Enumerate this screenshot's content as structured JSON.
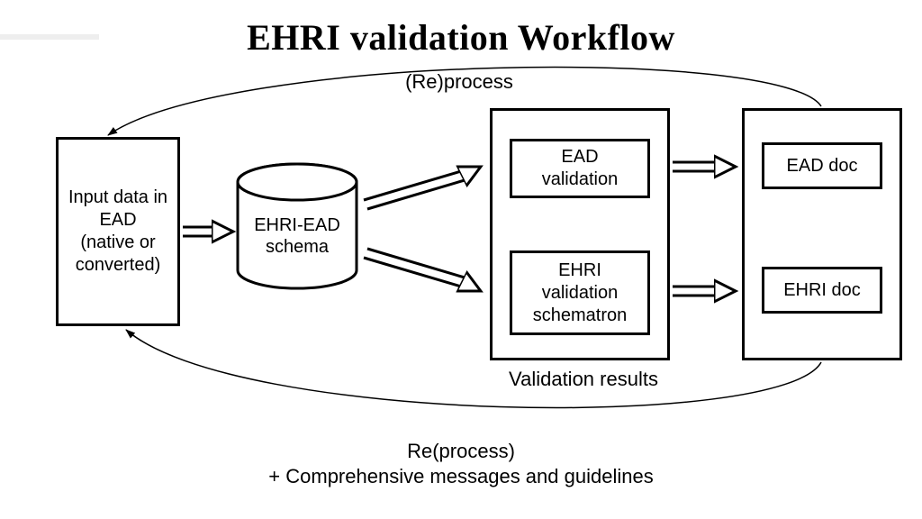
{
  "title": "EHRI validation Workflow",
  "labels": {
    "reprocess_top": "(Re)process",
    "reprocess_bottom": "Re(process)",
    "guidelines": "+ Comprehensive messages and guidelines",
    "validation_results": "Validation results"
  },
  "nodes": {
    "input": "Input data in\nEAD\n(native or\nconverted)",
    "schema": "EHRI-EAD\nschema",
    "ead_validation": "EAD\nvalidation",
    "ehri_validation": "EHRI\nvalidation\nschematron",
    "ead_doc": "EAD doc",
    "ehri_doc": "EHRI doc"
  }
}
